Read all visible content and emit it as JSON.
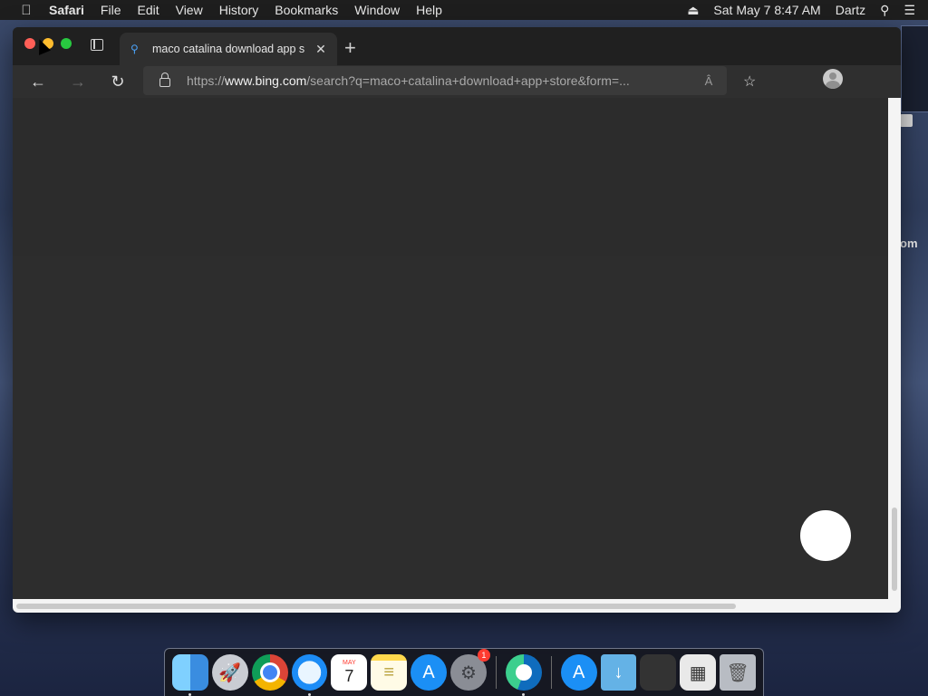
{
  "menubar": {
    "app_name": "Safari",
    "menus": [
      "File",
      "Edit",
      "View",
      "History",
      "Bookmarks",
      "Window",
      "Help"
    ],
    "datetime": "Sat May 7  8:47 AM",
    "user": "Dartz"
  },
  "background": {
    "partial_text": "om"
  },
  "browser": {
    "tab_title": "maco catalina download app s",
    "address": {
      "prefix": "https://",
      "host": "www.bing.com",
      "path": "/search?q=maco+catalina+download+app+store&form=..."
    },
    "read_aloud_label": "Â"
  },
  "dock": {
    "calendar_month": "MAY",
    "calendar_day": "7",
    "prefs_badge": "1"
  },
  "colors": {
    "menubar_bg": "#1e1e1e",
    "titlebar_bg": "#202020",
    "toolbar_bg": "#2f2f2f",
    "content_bg": "#2d2d2d",
    "close": "#fe5f57",
    "minimize": "#febc2e",
    "maximize": "#28c840"
  }
}
